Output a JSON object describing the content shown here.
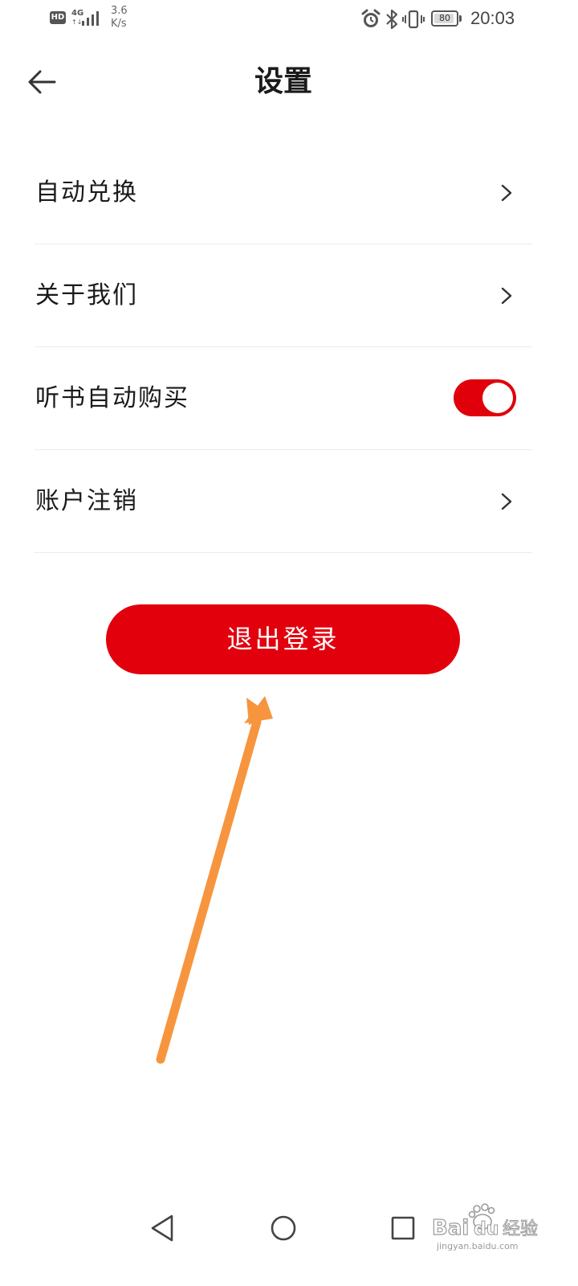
{
  "status_bar": {
    "hd": "HD",
    "network": "4G",
    "net_arrows": "↑↓",
    "speed_value": "3.6",
    "speed_unit": "K/s",
    "icons": [
      "alarm-icon",
      "bluetooth-icon",
      "vibrate-icon"
    ],
    "battery_level": "80",
    "time": "20:03"
  },
  "header": {
    "title": "设置",
    "back_icon": "arrow-left-icon"
  },
  "settings": {
    "items": [
      {
        "label": "自动兑换",
        "control": "chevron-right-icon"
      },
      {
        "label": "关于我们",
        "control": "chevron-right-icon"
      },
      {
        "label": "听书自动购买",
        "control": "toggle",
        "toggle_on": true
      },
      {
        "label": "账户注销",
        "control": "chevron-right-icon"
      }
    ]
  },
  "logout": {
    "label": "退出登录"
  },
  "colors": {
    "accent_red": "#e2000d",
    "annotation_arrow": "#f7953f",
    "divider": "#ececec"
  },
  "navigation": {
    "back_icon": "triangle-back-icon",
    "home_icon": "circle-home-icon",
    "recent_icon": "square-recents-icon"
  },
  "watermark": {
    "text": "Baidu经验",
    "url": "jingyan.baidu.com"
  }
}
